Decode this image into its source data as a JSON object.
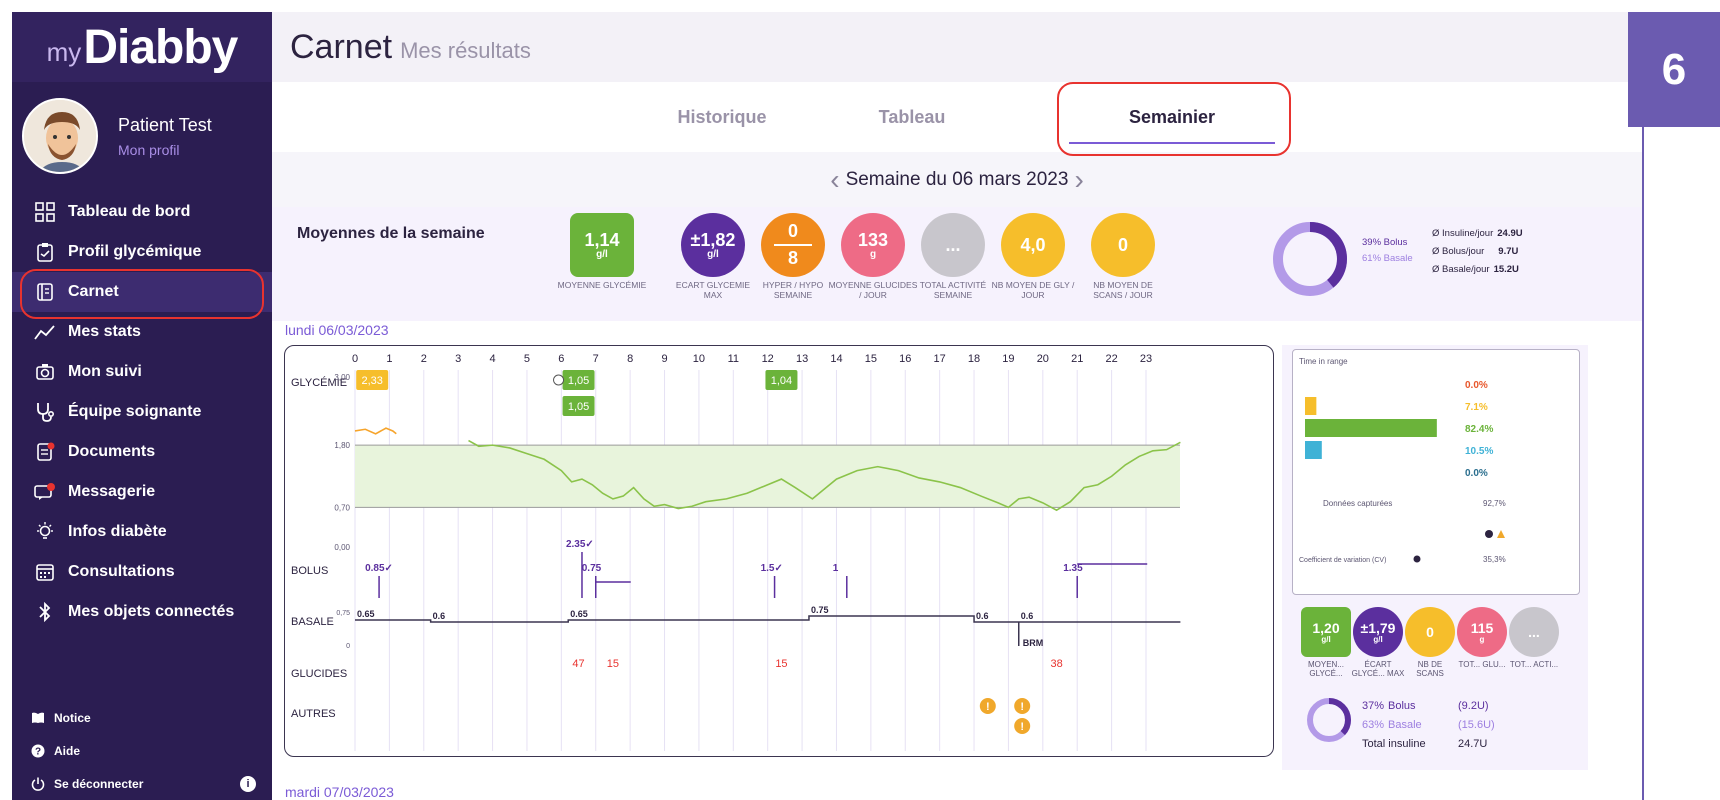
{
  "sidebar": {
    "logo_prefix": "my",
    "logo_brand": "Diabby",
    "profile_name": "Patient Test",
    "profile_link": "Mon profil",
    "items": [
      {
        "label": "Tableau de bord",
        "icon": "dashboard-icon"
      },
      {
        "label": "Profil glycémique",
        "icon": "clipboard-icon"
      },
      {
        "label": "Carnet",
        "icon": "notebook-icon",
        "active": true
      },
      {
        "label": "Mes stats",
        "icon": "stats-icon"
      },
      {
        "label": "Mon suivi",
        "icon": "camera-icon"
      },
      {
        "label": "Équipe soignante",
        "icon": "stethoscope-icon"
      },
      {
        "label": "Documents",
        "icon": "documents-icon"
      },
      {
        "label": "Messagerie",
        "icon": "messages-icon"
      },
      {
        "label": "Infos diabète",
        "icon": "lightbulb-icon"
      },
      {
        "label": "Consultations",
        "icon": "calendar-icon"
      },
      {
        "label": "Mes objets connectés",
        "icon": "bluetooth-icon"
      }
    ],
    "bottom": [
      {
        "label": "Notice",
        "icon": "book-icon"
      },
      {
        "label": "Aide",
        "icon": "help-icon"
      },
      {
        "label": "Se déconnecter",
        "icon": "power-icon"
      }
    ]
  },
  "header": {
    "title": "Carnet",
    "subtitle": "Mes résultats"
  },
  "tabs": [
    {
      "label": "Historique"
    },
    {
      "label": "Tableau"
    },
    {
      "label": "Semainier",
      "active": true
    }
  ],
  "week": {
    "label": "Semaine du 06 mars 2023"
  },
  "averages": {
    "title": "Moyennes de la semaine",
    "kpis": [
      {
        "value": "1,14",
        "unit": "g/l",
        "caption": "MOYENNE GLYCÉMIE",
        "color": "#6bb33a"
      },
      {
        "value": "±1,82",
        "unit": "g/l",
        "caption": "ECART GLYCEMIE MAX",
        "color": "#5b2f9e"
      },
      {
        "top": "0",
        "bottom": "8",
        "caption": "HYPER / HYPO SEMAINE",
        "color": "#f08a1c"
      },
      {
        "value": "133",
        "unit": "g",
        "caption": "MOYENNE GLUCIDES / JOUR",
        "color": "#ee6b86"
      },
      {
        "value": "...",
        "caption": "TOTAL ACTIVITÉ SEMAINE",
        "color": "#c8c6cc"
      },
      {
        "value": "4,0",
        "caption": "NB MOYEN DE GLY / JOUR",
        "color": "#f6be2b"
      },
      {
        "value": "0",
        "caption": "NB MOYEN DE SCANS / JOUR",
        "color": "#f6be2b"
      }
    ],
    "bolus_pct": "39% Bolus",
    "basale_pct": "61% Basale",
    "insuline_label": "Ø Insuline/jour",
    "insuline_value": "24.9U",
    "bolus_label": "Ø Bolus/jour",
    "bolus_value": "9.7U",
    "basale_label": "Ø Basale/jour",
    "basale_value": "15.2U",
    "bolus_fraction": 0.39
  },
  "day1": {
    "label": "lundi 06/03/2023",
    "hours": [
      "0",
      "1",
      "2",
      "3",
      "4",
      "5",
      "6",
      "7",
      "8",
      "9",
      "10",
      "11",
      "12",
      "13",
      "14",
      "15",
      "16",
      "17",
      "18",
      "19",
      "20",
      "21",
      "22",
      "23"
    ],
    "row_labels": {
      "glycemie": "GLYCÉMIE",
      "bolus": "BOLUS",
      "basale": "BASALE",
      "glucides": "GLUCIDES",
      "autres": "AUTRES"
    },
    "y_ticks": [
      "3,00",
      "1,80",
      "0,70",
      "0,00"
    ],
    "basale_ticks": [
      "0,75",
      "0"
    ],
    "glycemie_points": [
      {
        "hour": 0.5,
        "value": "2,33",
        "color": "#f6be2b"
      },
      {
        "hour": 6.5,
        "value": "1,05",
        "color": "#6bb33a"
      },
      {
        "hour": 6.5,
        "value": "1,05",
        "color": "#6bb33a",
        "row": 2
      },
      {
        "hour": 12.4,
        "value": "1,04",
        "color": "#6bb33a"
      }
    ],
    "bolus": [
      {
        "hour": 0.7,
        "label": "0.85",
        "checked": true
      },
      {
        "hour": 6.6,
        "label": "2.35",
        "checked": true
      },
      {
        "hour": 7.0,
        "label": "0.75",
        "checked": false
      },
      {
        "hour": 12.2,
        "label": "1.5",
        "checked": true
      },
      {
        "hour": 14.3,
        "label": "1",
        "checked": false
      },
      {
        "hour": 21.0,
        "label": "1.35",
        "checked": false
      }
    ],
    "basale": [
      {
        "hour": 0,
        "label": "0.65"
      },
      {
        "hour": 2.2,
        "label": "0.6"
      },
      {
        "hour": 6.2,
        "label": "0.65"
      },
      {
        "hour": 13.2,
        "label": "0.75"
      },
      {
        "hour": 18.0,
        "label": "0.6"
      },
      {
        "hour": 19.3,
        "label": "0.6"
      }
    ],
    "brm_label": "BRM",
    "glucides": [
      {
        "hour": 6.5,
        "label": "47"
      },
      {
        "hour": 7.5,
        "label": "15"
      },
      {
        "hour": 12.4,
        "label": "15"
      },
      {
        "hour": 20.4,
        "label": "38"
      }
    ],
    "autres": [
      {
        "hour": 18.4,
        "row": 0
      },
      {
        "hour": 19.4,
        "row": 0
      },
      {
        "hour": 19.4,
        "row": 1
      }
    ]
  },
  "tir": {
    "title": "Time in range",
    "values": [
      {
        "pct": "0.0%",
        "color": "#e8572b",
        "bar_fraction": 0.0
      },
      {
        "pct": "7.1%",
        "color": "#f6be2b",
        "bar_fraction": 0.071
      },
      {
        "pct": "82.4%",
        "color": "#6bb33a",
        "bar_fraction": 0.824
      },
      {
        "pct": "10.5%",
        "color": "#3fb2d6",
        "bar_fraction": 0.105
      },
      {
        "pct": "0.0%",
        "color": "#2a6e8e",
        "bar_fraction": 0.0
      }
    ],
    "captured_label": "Données capturées",
    "captured_value": "92,7%",
    "cv_label": "Coefficient de variation (CV)",
    "cv_value": "35,3%"
  },
  "day_kpis": [
    {
      "value": "1,20",
      "unit": "g/l",
      "caption": "MOYEN... GLYCÉ...",
      "color": "#6bb33a",
      "square": true
    },
    {
      "value": "±1,79",
      "unit": "g/l",
      "caption": "ÉCART GLYCÉ... MAX",
      "color": "#5b2f9e"
    },
    {
      "value": "0",
      "unit": "",
      "caption": "NB DE SCANS",
      "color": "#f6be2b"
    },
    {
      "value": "115",
      "unit": "g",
      "caption": "TOT... GLU...",
      "color": "#ee6b86"
    },
    {
      "value": "...",
      "unit": "",
      "caption": "TOT... ACTI...",
      "color": "#c8c6cc"
    }
  ],
  "day_totals": {
    "bolus_pct": "37%",
    "bolus_label": "Bolus",
    "bolus_value": "(9.2U)",
    "basale_pct": "63%",
    "basale_label": "Basale",
    "basale_value": "(15.6U)",
    "total_label": "Total insuline",
    "total_value": "24.7U",
    "bolus_fraction": 0.37
  },
  "day2": {
    "label": "mardi 07/03/2023"
  },
  "step_badge": "6"
}
